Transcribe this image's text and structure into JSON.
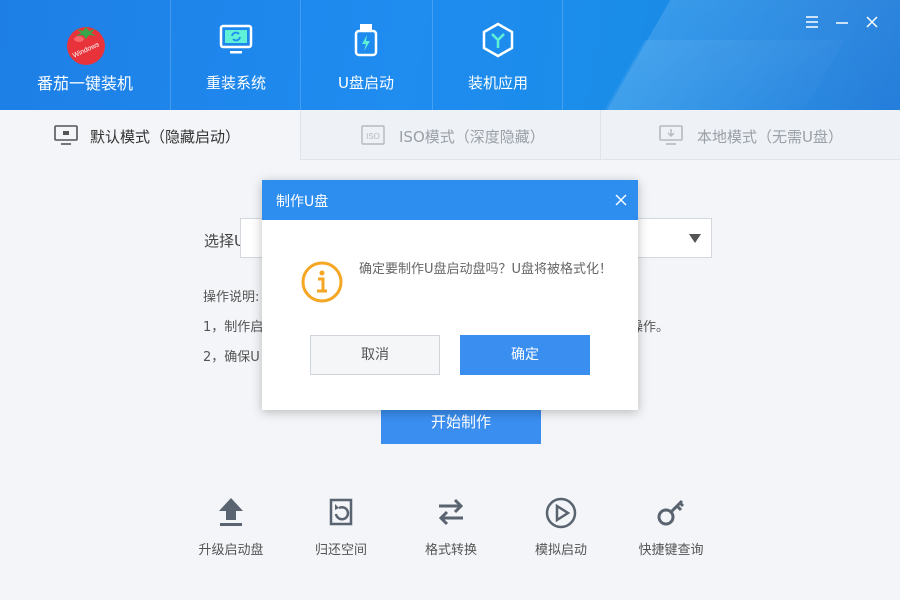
{
  "app": {
    "name": "番茄一键装机",
    "logo_text": "Windows"
  },
  "nav": {
    "items": [
      {
        "label": "重装系统",
        "icon": "monitor-refresh-icon"
      },
      {
        "label": "U盘启动",
        "icon": "usb-drive-icon"
      },
      {
        "label": "装机应用",
        "icon": "hexagon-app-icon"
      }
    ]
  },
  "window_controls": {
    "menu_icon": "menu-icon",
    "minimize_icon": "minimize-icon",
    "close_icon": "close-icon"
  },
  "tabs": [
    {
      "label": "默认模式（隐藏启动）",
      "icon": "monitor-icon",
      "active": true
    },
    {
      "label": "ISO模式（深度隐藏）",
      "icon": "iso-icon",
      "active": false
    },
    {
      "label": "本地模式（无需U盘）",
      "icon": "monitor-download-icon",
      "active": false
    }
  ],
  "content": {
    "select_label": "选择U盘",
    "select_value": "",
    "instructions_title": "操作说明:",
    "instruction_1": "1，制作启",
    "instruction_1_tail": "操作。",
    "instruction_2": "2，确保U",
    "start_button": "开始制作"
  },
  "tools": [
    {
      "label": "升级启动盘",
      "icon": "upload-arrow-icon"
    },
    {
      "label": "归还空间",
      "icon": "restore-space-icon"
    },
    {
      "label": "格式转换",
      "icon": "convert-arrows-icon"
    },
    {
      "label": "模拟启动",
      "icon": "play-circle-icon"
    },
    {
      "label": "快捷键查询",
      "icon": "key-icon"
    }
  ],
  "dialog": {
    "title": "制作U盘",
    "message": "确定要制作U盘启动盘吗？U盘将被格式化！",
    "cancel": "取消",
    "ok": "确定"
  },
  "colors": {
    "header_blue": "#1f8cf0",
    "accent_blue": "#3a8ef0",
    "warning_orange": "#f5a623"
  }
}
